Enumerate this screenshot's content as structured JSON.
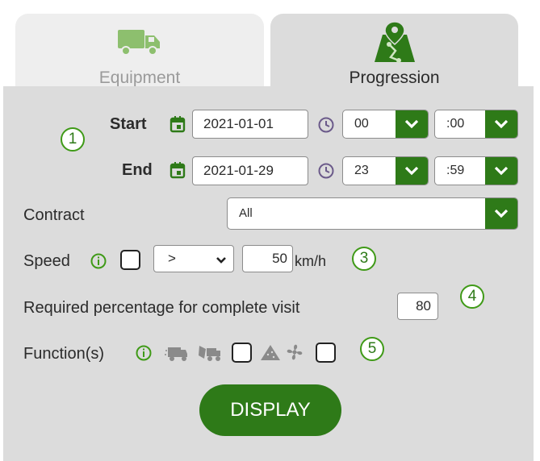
{
  "tabs": {
    "equipment_label": "Equipment",
    "progression_label": "Progression"
  },
  "badges": [
    "1",
    "3",
    "4",
    "5"
  ],
  "start": {
    "label": "Start",
    "date": "2021-01-01",
    "hour": "00",
    "minute": ":00"
  },
  "end": {
    "label": "End",
    "date": "2021-01-29",
    "hour": "23",
    "minute": ":59"
  },
  "contract": {
    "label": "Contract",
    "value": "All"
  },
  "speed": {
    "label": "Speed",
    "operator": ">",
    "value": "50",
    "unit": "km/h"
  },
  "percentage": {
    "label": "Required percentage for complete visit",
    "value": "80"
  },
  "functions": {
    "label": "Function(s)"
  },
  "display_button": "DISPLAY",
  "colors": {
    "accent": "#2e7a18",
    "badge_border": "#3f9a17",
    "panel": "#dcdcdc",
    "inactive_tab": "#eeeeee"
  },
  "icons": [
    "truck-icon",
    "map-route-icon",
    "calendar-icon",
    "clock-icon",
    "chevron-down-icon",
    "info-icon",
    "salt-spreader-icon",
    "snow-plow-icon",
    "sand-pile-icon",
    "fan-icon"
  ]
}
